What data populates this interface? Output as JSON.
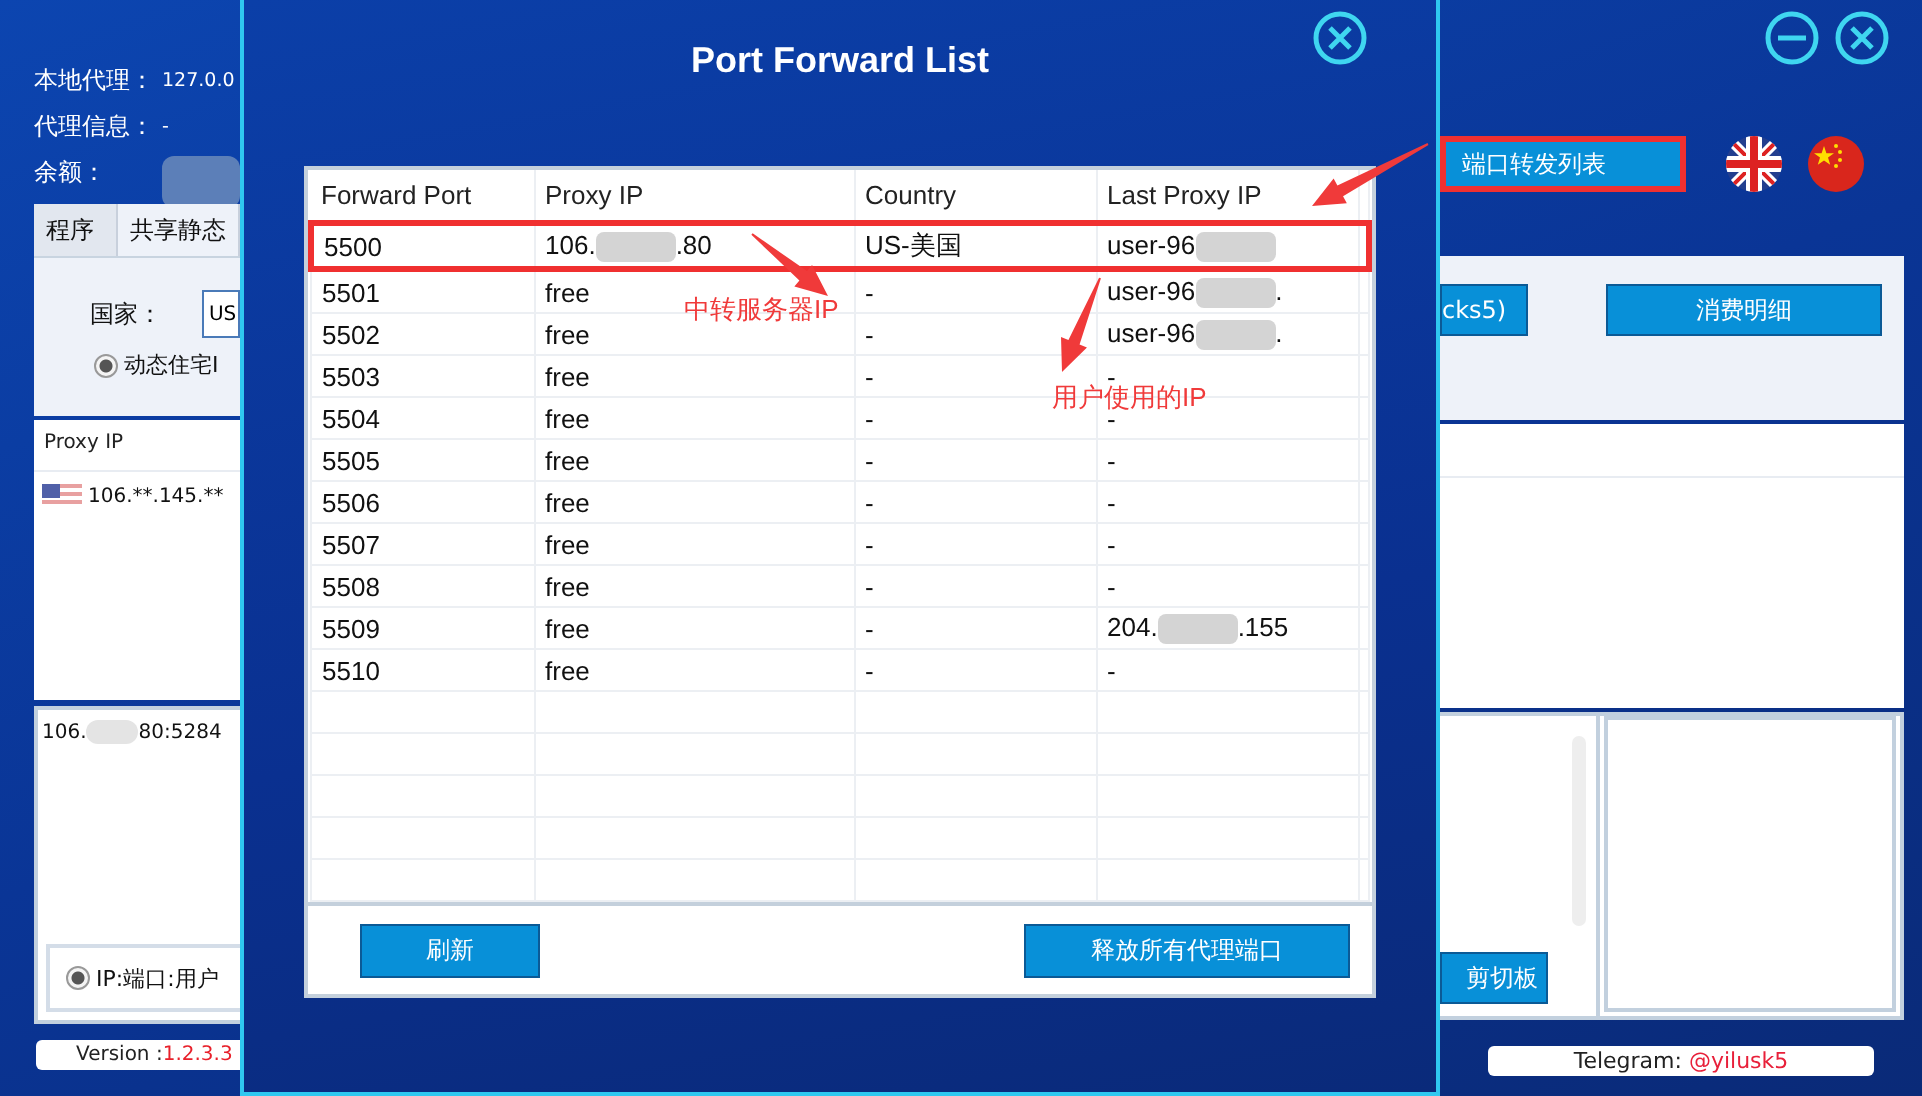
{
  "app": {
    "local_proxy_label": "本地代理：",
    "local_proxy_value": "127.0.0",
    "proxy_info_label": "代理信息：",
    "proxy_info_value": "-",
    "balance_label": "余额：",
    "balance_redacted": true,
    "tabs": [
      {
        "label": "程序",
        "selected": false
      },
      {
        "label": "共享静态",
        "selected": true
      }
    ],
    "country_label": "国家：",
    "country_value": "US",
    "proxy_type": {
      "label": "动态住宅I",
      "selected": true
    },
    "proxy_list": {
      "column": "Proxy IP",
      "rows": [
        {
          "kind": "us",
          "ip": "106.**.145.**"
        }
      ]
    },
    "output_text": {
      "parts": [
        "106.",
        "80:5284"
      ]
    },
    "format_option": {
      "label": "IP:端口:用户",
      "selected": true
    },
    "version_label": "Version : ",
    "version": "1.2.3.3",
    "port_forward_button": {
      "label": "端口转发列表",
      "highlighted": true
    },
    "languages": [
      {
        "kind": "uk"
      },
      {
        "kind": "cn"
      }
    ],
    "socks_button": "cks5)",
    "consumption_button": "消费明细",
    "clipboard_button": "剪切板",
    "telegram_label": "Telegram: ",
    "telegram_handle": "@yilusk5"
  },
  "dialog": {
    "title": "Port Forward List",
    "columns": [
      "Forward Port",
      "Proxy IP",
      "Country",
      "Last Proxy IP"
    ],
    "rows": [
      {
        "port": "5500",
        "proxy_ip": {
          "parts": [
            "106.",
            ".80"
          ]
        },
        "country": "US-美国",
        "last_proxy_ip": {
          "parts": [
            "user-96"
          ],
          "blur_end": true
        },
        "highlighted": true
      },
      {
        "port": "5501",
        "proxy_ip": "free",
        "country": "-",
        "last_proxy_ip": {
          "parts": [
            "user-96",
            "."
          ]
        },
        "highlighted": false
      },
      {
        "port": "5502",
        "proxy_ip": "free",
        "country": "-",
        "last_proxy_ip": {
          "parts": [
            "user-96",
            "."
          ]
        },
        "highlighted": false
      },
      {
        "port": "5503",
        "proxy_ip": "free",
        "country": "-",
        "last_proxy_ip": "-",
        "highlighted": false
      },
      {
        "port": "5504",
        "proxy_ip": "free",
        "country": "-",
        "last_proxy_ip": "-",
        "highlighted": false
      },
      {
        "port": "5505",
        "proxy_ip": "free",
        "country": "-",
        "last_proxy_ip": "-",
        "highlighted": false
      },
      {
        "port": "5506",
        "proxy_ip": "free",
        "country": "-",
        "last_proxy_ip": "-",
        "highlighted": false
      },
      {
        "port": "5507",
        "proxy_ip": "free",
        "country": "-",
        "last_proxy_ip": "-",
        "highlighted": false
      },
      {
        "port": "5508",
        "proxy_ip": "free",
        "country": "-",
        "last_proxy_ip": "-",
        "highlighted": false
      },
      {
        "port": "5509",
        "proxy_ip": "free",
        "country": "-",
        "last_proxy_ip": {
          "parts": [
            "204.",
            ".155"
          ]
        },
        "highlighted": false
      },
      {
        "port": "5510",
        "proxy_ip": "free",
        "country": "-",
        "last_proxy_ip": "-",
        "highlighted": false
      }
    ],
    "buttons": [
      "刷新",
      "释放所有代理端口"
    ]
  },
  "annotations": {
    "server_ip_note": "中转服务器IP",
    "user_ip_note": "用户使用的IP"
  }
}
